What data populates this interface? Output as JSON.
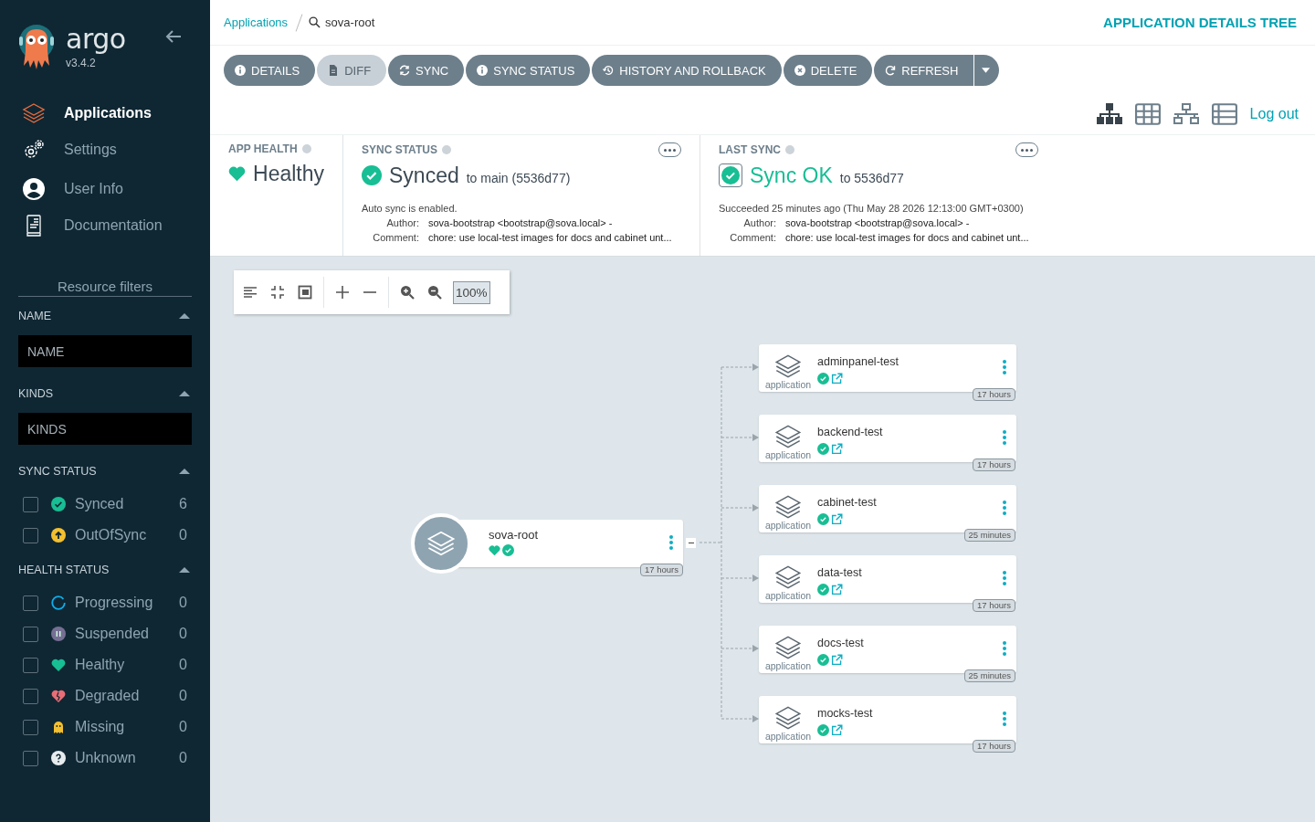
{
  "sidebar": {
    "logo": "argo",
    "version": "v3.4.2",
    "nav": [
      {
        "label": "Applications",
        "kind": "apps",
        "selected": true
      },
      {
        "label": "Settings",
        "kind": "settings",
        "selected": false
      },
      {
        "label": "User Info",
        "kind": "user",
        "selected": false
      },
      {
        "label": "Documentation",
        "kind": "docs",
        "selected": false
      }
    ],
    "filters_title": "Resource filters",
    "name_filter": {
      "label": "NAME",
      "placeholder": "NAME"
    },
    "kinds_filter": {
      "label": "KINDS",
      "placeholder": "KINDS"
    },
    "sync_status": {
      "title": "SYNC STATUS",
      "items": [
        {
          "label": "Synced",
          "kind": "synced",
          "count": "6",
          "checked": false
        },
        {
          "label": "OutOfSync",
          "kind": "outofsync",
          "count": "0",
          "checked": false
        }
      ]
    },
    "health_status": {
      "title": "HEALTH STATUS",
      "items": [
        {
          "label": "Progressing",
          "kind": "progressing",
          "count": "0",
          "checked": false
        },
        {
          "label": "Suspended",
          "kind": "suspended",
          "count": "0",
          "checked": false
        },
        {
          "label": "Healthy",
          "kind": "healthy",
          "count": "0",
          "checked": false
        },
        {
          "label": "Degraded",
          "kind": "degraded",
          "count": "0",
          "checked": false
        },
        {
          "label": "Missing",
          "kind": "missing",
          "count": "0",
          "checked": false
        },
        {
          "label": "Unknown",
          "kind": "unknown",
          "count": "0",
          "checked": false
        }
      ]
    }
  },
  "topbar": {
    "breadcrumb": [
      "Applications",
      "sova-root"
    ],
    "title": "APPLICATION DETAILS TREE"
  },
  "actions": [
    {
      "label": "DETAILS",
      "kind": "info",
      "disabled": false
    },
    {
      "label": "DIFF",
      "kind": "file",
      "disabled": true
    },
    {
      "label": "SYNC",
      "kind": "sync",
      "disabled": false
    },
    {
      "label": "SYNC STATUS",
      "kind": "info",
      "disabled": false
    },
    {
      "label": "HISTORY AND ROLLBACK",
      "kind": "history",
      "disabled": false
    },
    {
      "label": "DELETE",
      "kind": "delete",
      "disabled": false
    },
    {
      "label": "REFRESH",
      "kind": "refresh",
      "disabled": false
    }
  ],
  "views": [
    {
      "kind": "tree",
      "selected": true
    },
    {
      "kind": "grid",
      "selected": false
    },
    {
      "kind": "network",
      "selected": false
    },
    {
      "kind": "list",
      "selected": false
    }
  ],
  "logout": "Log out",
  "app_health": {
    "title": "APP HEALTH",
    "status": "Healthy"
  },
  "sync_status": {
    "title": "SYNC STATUS",
    "status": "Synced",
    "target": "to main (5536d77)",
    "note": "Auto sync is enabled.",
    "author_label": "Author:",
    "author": "sova-bootstrap <bootstrap@sova.local> -",
    "comment_label": "Comment:",
    "comment": "chore: use local-test images for docs and cabinet unt..."
  },
  "last_sync": {
    "title": "LAST SYNC",
    "status": "Sync OK",
    "target": "to 5536d77",
    "note": "Succeeded 25 minutes ago (Thu May 28 2026 12:13:00 GMT+0300)",
    "author_label": "Author:",
    "author": "sova-bootstrap <bootstrap@sova.local> -",
    "comment_label": "Comment:",
    "comment": "chore: use local-test images for docs and cabinet unt..."
  },
  "graph_toolbar": {
    "zoom": "100%"
  },
  "root": {
    "name": "sova-root",
    "age": "17 hours"
  },
  "children": [
    {
      "name": "adminpanel-test",
      "type": "application",
      "age": "17 hours"
    },
    {
      "name": "backend-test",
      "type": "application",
      "age": "17 hours"
    },
    {
      "name": "cabinet-test",
      "type": "application",
      "age": "25 minutes"
    },
    {
      "name": "data-test",
      "type": "application",
      "age": "17 hours"
    },
    {
      "name": "docs-test",
      "type": "application",
      "age": "25 minutes"
    },
    {
      "name": "mocks-test",
      "type": "application",
      "age": "17 hours"
    }
  ]
}
